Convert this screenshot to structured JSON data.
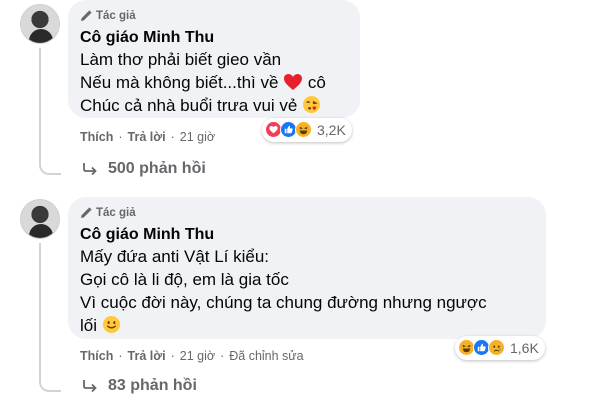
{
  "comments": [
    {
      "badge": "Tác giả",
      "author": "Cô giáo Minh Thu",
      "lines": [
        "Làm thơ phải biết gieo vần",
        "Nếu mà không biết...thì về",
        "cô",
        "Chúc cả nhà buổi trưa vui vẻ"
      ],
      "icons": [
        "heart-emoji",
        "blow-kiss-emoji"
      ],
      "actions": {
        "like": "Thích",
        "reply": "Trả lời",
        "time": "21 giờ"
      },
      "reactions": {
        "icons": [
          "love-reaction",
          "like-reaction",
          "haha-reaction"
        ],
        "count": "3,2K"
      },
      "replies": "500 phản hồi"
    },
    {
      "badge": "Tác giả",
      "author": "Cô giáo Minh Thu",
      "lines": [
        "Mấy đứa anti Vật Lí kiểu:",
        "Gọi cô là li độ, em là gia tốc",
        "Vì cuộc đời này, chúng ta chung đường nhưng ngược",
        "lối"
      ],
      "icons": [
        "smile-emoji"
      ],
      "actions": {
        "like": "Thích",
        "reply": "Trả lời",
        "time": "21 giờ",
        "edited": "Đã chỉnh sửa"
      },
      "reactions": {
        "icons": [
          "haha-reaction",
          "like-reaction",
          "sad-reaction"
        ],
        "count": "1,6K"
      },
      "replies": "83 phản hồi"
    }
  ],
  "colors": {
    "bubble": "#f0f2f5",
    "meta_text": "#65676b",
    "like_blue": "#1877f2",
    "love_red": "#f33e58",
    "haha_yellow": "#f7b125"
  }
}
